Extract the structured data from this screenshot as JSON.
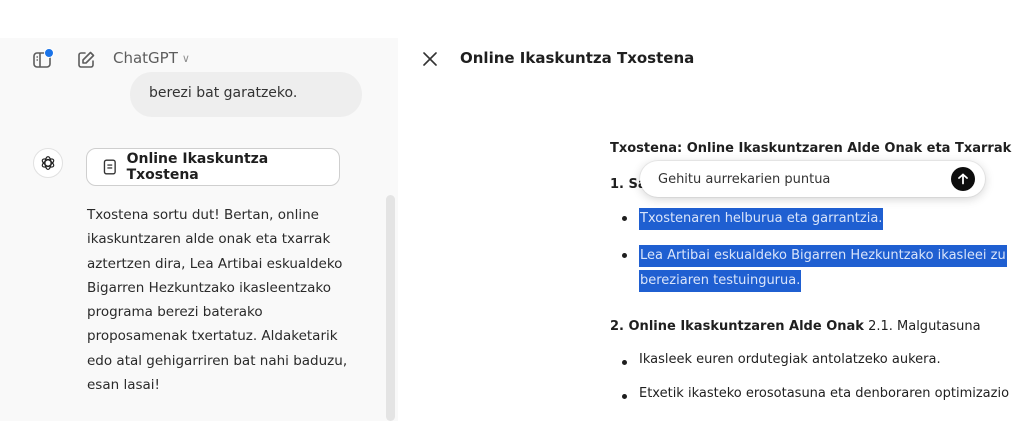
{
  "header": {
    "model_name": "ChatGPT",
    "model_caret": "∨",
    "panel_title": "Online Ikaskuntza Txostena",
    "accent_color": "#1a73e8"
  },
  "chat": {
    "user_message_tail": "berezi bat garatzeko.",
    "document_chip_label": "Online Ikaskuntza Txostena",
    "assistant_message": [
      "Txostena sortu dut! Bertan, online",
      "ikaskuntzaren alde onak eta txarrak",
      "aztertzen dira, Lea Artibai eskualdeko",
      "Bigarren Hezkuntzako ikasleentzako",
      "programa berezi baterako",
      "proposamenak txertatuz. Aldaketarik",
      "edo atal gehigarriren bat nahi baduzu,",
      "esan lasai!"
    ]
  },
  "document": {
    "heading": "Txostena: Online Ikaskuntzaren Alde Onak eta Txarrak",
    "section1_label_visible": "1. Sa",
    "bullets_selected": [
      "Txostenaren helburua eta garrantzia.",
      "Lea Artibai eskualdeko Bigarren Hezkuntzako ikasleei zu",
      "bereziaren testuingurua."
    ],
    "section2_heading": "2. Online Ikaskuntzaren Alde Onak",
    "section2_sub": "2.1. Malgutasuna",
    "bullets": [
      "Ikasleek euren ordutegiak antolatzeko aukera.",
      "Etxetik ikasteko erosotasuna eta denboraren optimizazio"
    ],
    "highlight_color": "#1f5fd1"
  },
  "floating_prompt": {
    "placeholder": "Gehitu aurrekarien puntua"
  },
  "icons": [
    "sidebar-toggle-icon",
    "new-chat-icon",
    "openai-logo-icon",
    "document-icon",
    "close-icon",
    "arrow-up-icon"
  ]
}
